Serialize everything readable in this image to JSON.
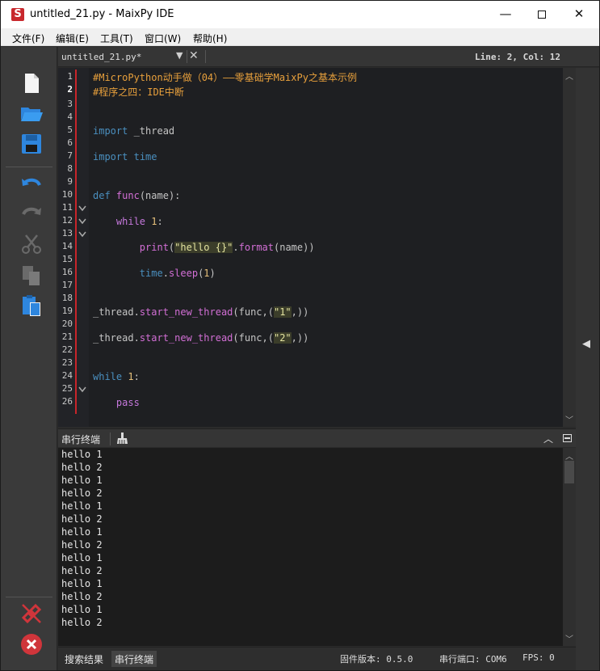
{
  "window": {
    "title": "untitled_21.py - MaixPy IDE",
    "logo_letter": "S"
  },
  "window_controls": {
    "minimize": "—",
    "close": "✕"
  },
  "menu": [
    "文件(F)",
    "编辑(E)",
    "工具(T)",
    "窗口(W)",
    "帮助(H)"
  ],
  "toolbar": {
    "icons": [
      "new-file-icon",
      "open-folder-icon",
      "save-icon",
      "undo-icon",
      "redo-icon",
      "cut-icon",
      "copy-icon",
      "paste-icon",
      "disconnect-icon",
      "stop-icon"
    ]
  },
  "editor": {
    "tab_label": "untitled_21.py*",
    "dropdown_glyph": "▼",
    "close_glyph": "✕",
    "cursor_position": "Line: 2, Col: 12",
    "line_numbers": [
      "1",
      "2",
      "3",
      "4",
      "5",
      "6",
      "7",
      "8",
      "9",
      "10",
      "11",
      "12",
      "13",
      "14",
      "15",
      "16",
      "17",
      "18",
      "19",
      "20",
      "21",
      "22",
      "23",
      "24",
      "25",
      "26"
    ],
    "code": {
      "l1": "#MicroPython动手做（04）——零基础学MaixPy之基本示例",
      "l2": "#程序之四：IDE中断",
      "l5_kw": "import",
      "l5_mod": " _thread",
      "l7_kw": "import",
      "l7_mod": "time",
      "l10_kw": "def",
      "l10_fn": "func",
      "l10_rest": "(name):",
      "l12_kw": "while",
      "l12_num": "1",
      "l12_rest": ":",
      "l14_fn": "print",
      "l14_p1": "(",
      "l14_str": "\"hello {}\"",
      "l14_dot": ".",
      "l14_fmt": "format",
      "l14_rest": "(name))",
      "l16_mod": "time",
      "l16_dot": ".",
      "l16_fn": "sleep",
      "l16_p": "(",
      "l16_num": "1",
      "l16_p2": ")",
      "l19_mod": "_thread",
      "l19_dot": ".",
      "l19_fn": "start_new_thread",
      "l19_a": "(func,(",
      "l19_str": "\"1\"",
      "l19_b": ",))",
      "l21_mod": "_thread",
      "l21_dot": ".",
      "l21_fn": "start_new_thread",
      "l21_a": "(func,(",
      "l21_str": "\"2\"",
      "l21_b": ",))",
      "l24_kw": "while",
      "l24_num": "1",
      "l24_rest": ":",
      "l26_kw": "pass"
    }
  },
  "terminal": {
    "title": "串行终端",
    "lines": [
      "hello 1",
      "hello 2",
      "hello 1",
      "hello 2",
      "hello 1",
      "hello 2",
      "hello 1",
      "hello 2",
      "hello 1",
      "hello 2",
      "hello 1",
      "hello 2",
      "hello 1",
      "hello 2"
    ]
  },
  "statusbar": {
    "tab_search": "搜索结果",
    "tab_serial": "串行终端",
    "firmware": "固件版本: 0.5.0",
    "serial_port": "串行端口: COM6",
    "fps": "FPS: 0"
  },
  "colors": {
    "accent_red": "#c8252a",
    "icon_blue": "#2e86de",
    "comment": "#e8a03c"
  }
}
